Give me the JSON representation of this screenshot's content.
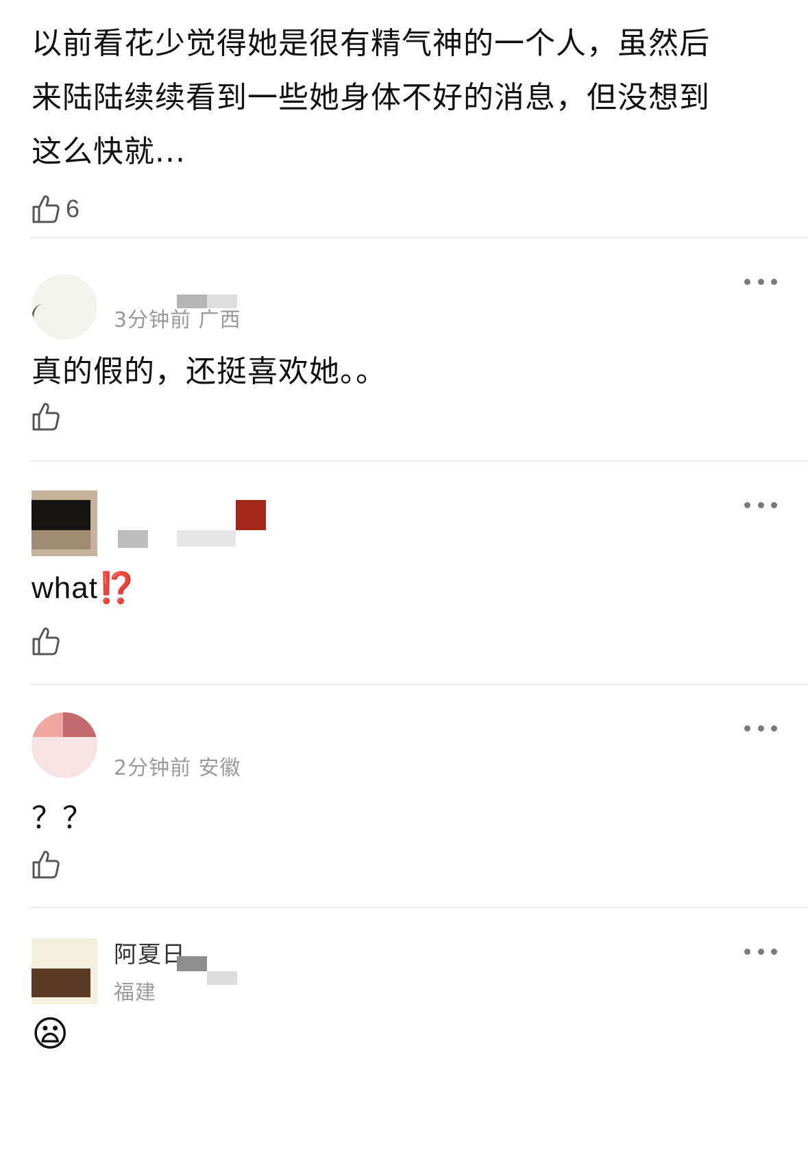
{
  "top_comment": {
    "lines": [
      "以前看花少觉得她是很有精气神的一个人，虽然后",
      "来陆陆续续看到一些她身体不好的消息，但没想到",
      "这么快就..."
    ],
    "like_count": "6"
  },
  "comments": [
    {
      "username": "",
      "meta": "3分钟前 广西",
      "text": "真的假的，还挺喜欢她。。",
      "like_count": ""
    },
    {
      "username": "",
      "meta": "",
      "text": "what",
      "emoji": "⁉️",
      "like_count": ""
    },
    {
      "username": "",
      "meta": "2分钟前 安徽",
      "text": "？？",
      "like_count": ""
    },
    {
      "username": "阿夏日",
      "meta": "福建",
      "text": "😦",
      "like_count": ""
    }
  ],
  "icons": {
    "like": "thumbs-up-icon",
    "more": "more-dots-icon"
  },
  "colors": {
    "text": "#111111",
    "meta": "#9a9a9a",
    "divider": "#ececec",
    "icon": "#555555",
    "emoji_red": "#d43a25"
  }
}
